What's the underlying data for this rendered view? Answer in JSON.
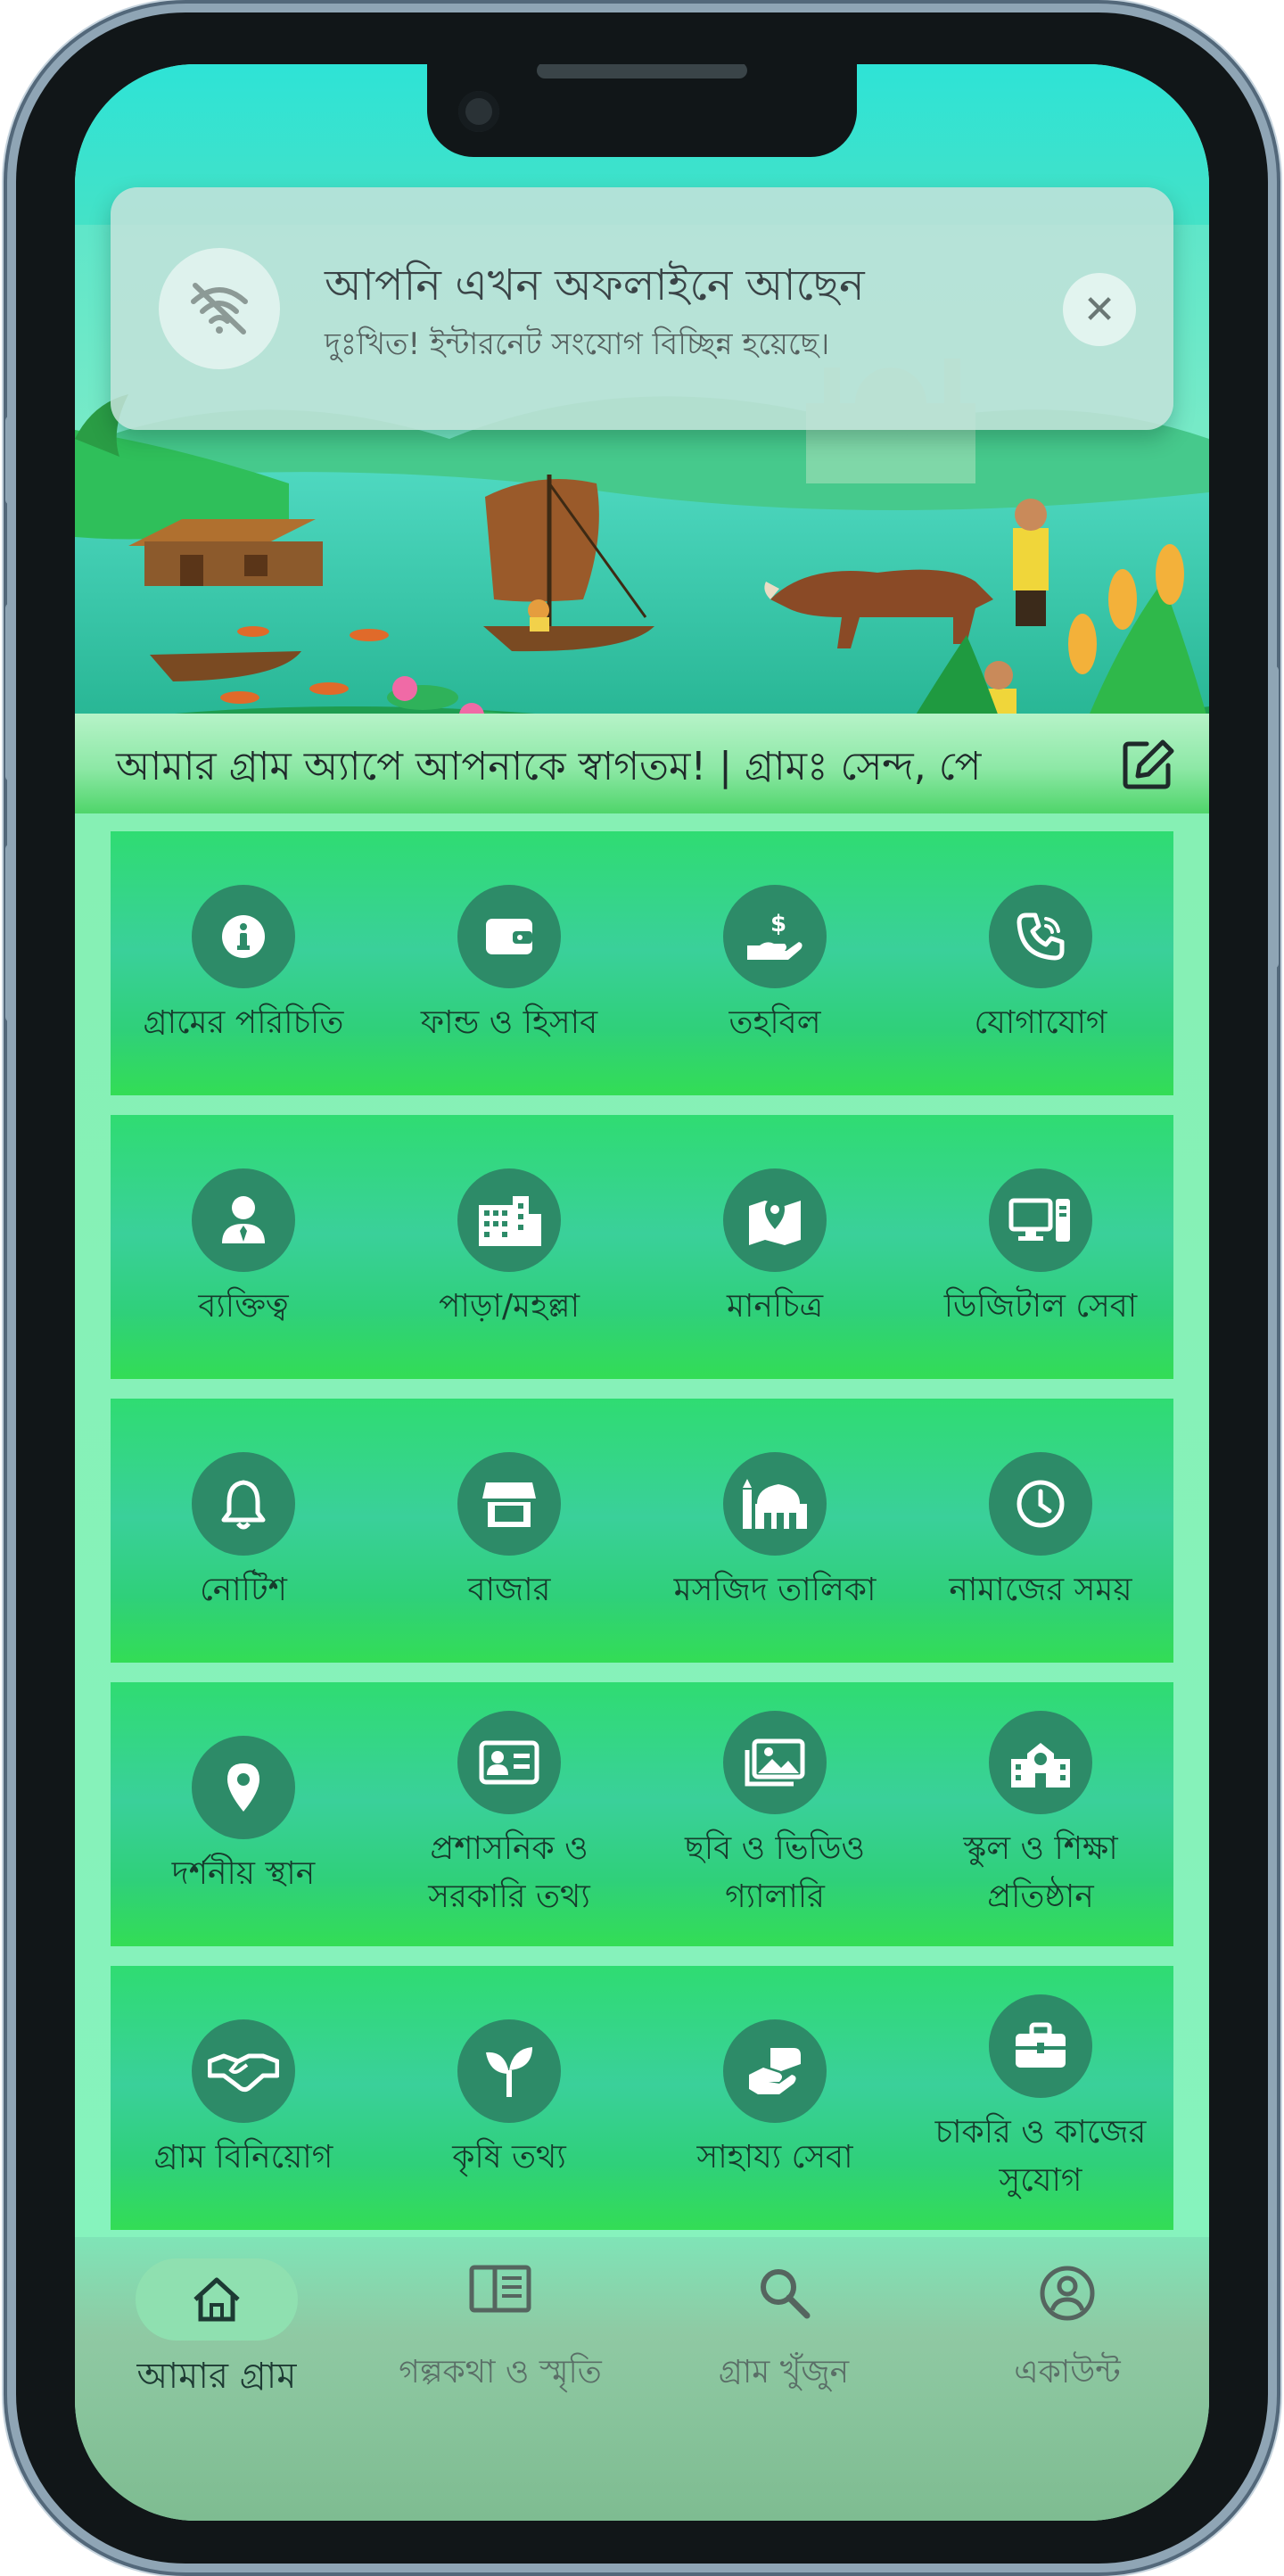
{
  "offline_alert": {
    "title": "আপনি এখন অফলাইনে আছেন",
    "message": "দুঃখিত! ইন্টারনেট সংযোগ বিচ্ছিন্ন হয়েছে।",
    "close_glyph": "✕",
    "icon": "wifi-off-icon"
  },
  "welcome_bar": {
    "text": "আমার গ্রাম অ্যাপে আপনাকে স্বাগতম! | গ্রামঃ সেন্দ, পে",
    "edit_icon": "edit-icon"
  },
  "menu_rows": [
    [
      {
        "label": "গ্রামের পরিচিতি",
        "icon": "info-icon"
      },
      {
        "label": "ফান্ড ও হিসাব",
        "icon": "wallet-icon"
      },
      {
        "label": "তহবিল",
        "icon": "hand-dollar-icon"
      },
      {
        "label": "যোগাযোগ",
        "icon": "phone-call-icon"
      }
    ],
    [
      {
        "label": "ব্যক্তিত্ব",
        "icon": "person-tie-icon"
      },
      {
        "label": "পাড়া/মহল্লা",
        "icon": "buildings-icon"
      },
      {
        "label": "মানচিত্র",
        "icon": "map-icon"
      },
      {
        "label": "ডিজিটাল সেবা",
        "icon": "computer-icon"
      }
    ],
    [
      {
        "label": "নোটিশ",
        "icon": "bell-icon"
      },
      {
        "label": "বাজার",
        "icon": "store-icon"
      },
      {
        "label": "মসজিদ তালিকা",
        "icon": "mosque-icon"
      },
      {
        "label": "নামাজের সময়",
        "icon": "clock-icon"
      }
    ],
    [
      {
        "label": "দর্শনীয় স্থান",
        "icon": "location-pin-icon"
      },
      {
        "label": "প্রশাসনিক ও",
        "label2": "সরকারি তথ্য",
        "icon": "id-card-icon"
      },
      {
        "label": "ছবি ও ভিডিও",
        "label2": "গ্যালারি",
        "icon": "gallery-icon"
      },
      {
        "label": "স্কুল ও শিক্ষা",
        "label2": "প্রতিষ্ঠান",
        "icon": "school-icon"
      }
    ],
    [
      {
        "label": "গ্রাম বিনিয়োগ",
        "icon": "handshake-icon"
      },
      {
        "label": "কৃষি তথ্য",
        "icon": "sprout-icon"
      },
      {
        "label": "সাহায্য সেবা",
        "icon": "helping-hand-icon"
      },
      {
        "label": "চাকরি ও কাজের",
        "label2": "সুযোগ",
        "icon": "briefcase-icon"
      }
    ]
  ],
  "bottom_nav": [
    {
      "label": "আমার গ্রাম",
      "icon": "home-icon",
      "active": true
    },
    {
      "label": "গল্পকথা ও স্মৃতি",
      "icon": "book-icon",
      "active": false
    },
    {
      "label": "গ্রাম খুঁজুন",
      "icon": "search-icon",
      "active": false
    },
    {
      "label": "একাউন্ট",
      "icon": "account-icon",
      "active": false
    }
  ],
  "colors": {
    "accent_dark_green": "#2d8b68",
    "card_green": "#33d27a",
    "background_mint": "#86f0b4",
    "top_cyan": "#2ee3d6"
  }
}
